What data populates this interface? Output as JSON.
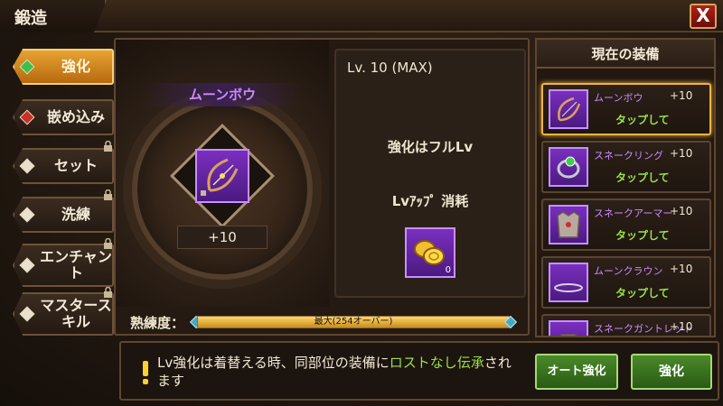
{
  "window": {
    "title": "鍛造",
    "close_label": "X"
  },
  "nav": {
    "items": [
      {
        "label": "強化",
        "active": true,
        "locked": false,
        "gem_color": "#3fbf4a"
      },
      {
        "label": "嵌め込み",
        "active": false,
        "locked": false,
        "gem_color": "#c8302a"
      },
      {
        "label": "セット",
        "active": false,
        "locked": true,
        "gem_color": "#e8e0d0"
      },
      {
        "label": "洗練",
        "active": false,
        "locked": true,
        "gem_color": "#e8e0d0"
      },
      {
        "label": "エンチャント",
        "active": false,
        "locked": true,
        "gem_color": "#e8e0d0"
      },
      {
        "label": "マスタースキル",
        "active": false,
        "locked": true,
        "gem_color": "#e8e0d0"
      }
    ]
  },
  "item": {
    "name": "ムーンボウ",
    "plus": "+10",
    "icon": "bow-icon"
  },
  "info": {
    "level": "Lv. 10 (MAX)",
    "full_message": "強化はフルLv",
    "cost_label": "Lvｱｯﾌﾟ 消耗",
    "cost_icon": "gold-coins-icon",
    "cost_count": "0"
  },
  "proficiency": {
    "label": "熟練度：",
    "bar_text": "最大(254オーバー)",
    "fill_fraction": 1.0
  },
  "equipment": {
    "header": "現在の装備",
    "items": [
      {
        "name": "ムーンボウ",
        "plus": "+10",
        "action": "タップして",
        "icon": "bow-icon",
        "selected": true
      },
      {
        "name": "スネークリング",
        "plus": "+10",
        "action": "タップして",
        "icon": "ring-icon",
        "selected": false
      },
      {
        "name": "スネークアーマー",
        "plus": "+10",
        "action": "タップして",
        "icon": "armor-icon",
        "selected": false
      },
      {
        "name": "ムーンクラウン",
        "plus": "+10",
        "action": "タップして",
        "icon": "crown-icon",
        "selected": false
      },
      {
        "name": "スネークガントレット",
        "plus": "+10",
        "action": "",
        "icon": "gauntlet-icon",
        "selected": false
      }
    ]
  },
  "notice": {
    "part1": "Lv強化は着替える時、同部位の装備に",
    "highlight1": "ロストなし",
    "part2": "",
    "highlight2": "伝承",
    "part3": "されます"
  },
  "buttons": {
    "auto_enhance": "オート強化",
    "enhance": "強化"
  },
  "colors": {
    "accent_green": "#9ae04a",
    "item_purple": "#c98cff",
    "gold": "#e7a232"
  }
}
